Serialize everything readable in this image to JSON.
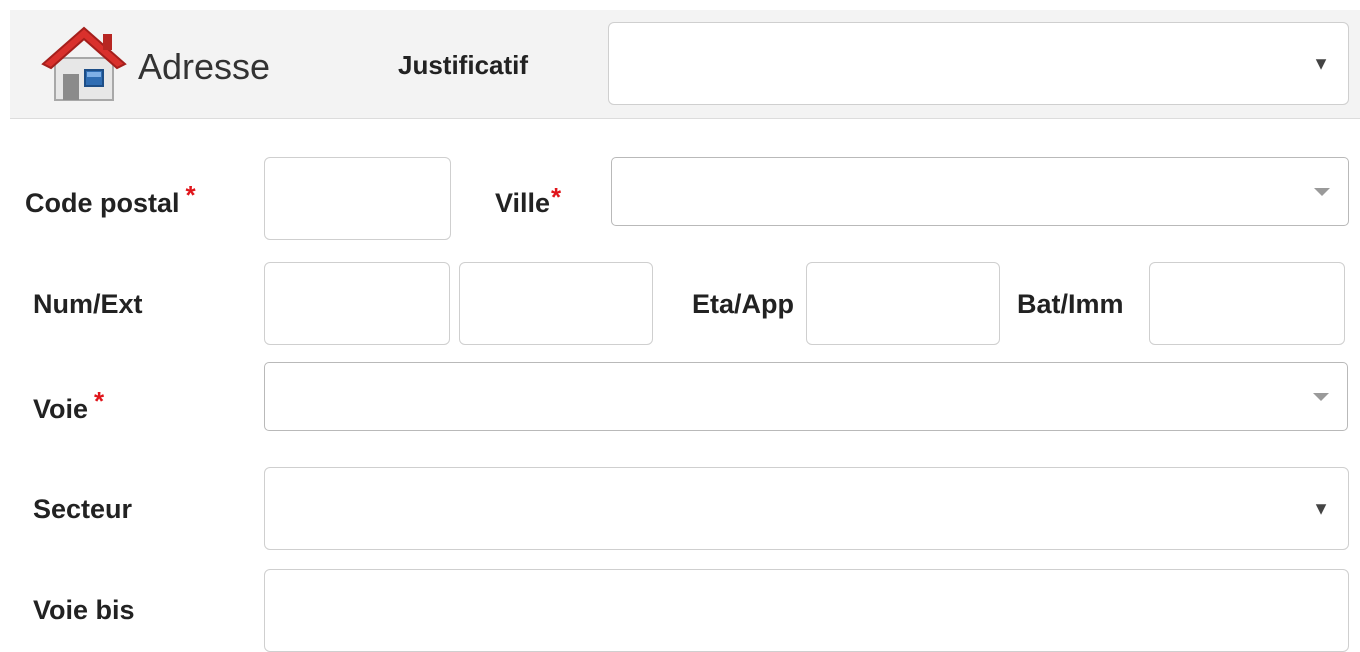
{
  "header": {
    "title": "Adresse",
    "icon": "home-icon",
    "justificatif_label": "Justificatif",
    "justificatif_value": ""
  },
  "form": {
    "code_postal": {
      "label": "Code postal",
      "required": "*",
      "value": ""
    },
    "ville": {
      "label": "Ville",
      "required": "*",
      "value": ""
    },
    "num_ext": {
      "label": "Num/Ext",
      "num_value": "",
      "ext_value": ""
    },
    "eta_app": {
      "label": "Eta/App",
      "value": ""
    },
    "bat_imm": {
      "label": "Bat/Imm",
      "value": ""
    },
    "voie": {
      "label": "Voie",
      "required": "*",
      "value": ""
    },
    "secteur": {
      "label": "Secteur",
      "value": ""
    },
    "voie_bis": {
      "label": "Voie bis",
      "value": ""
    }
  },
  "colors": {
    "required_asterisk": "#e0151b",
    "header_bg": "#f3f3f3",
    "roof": "#d9302c"
  }
}
